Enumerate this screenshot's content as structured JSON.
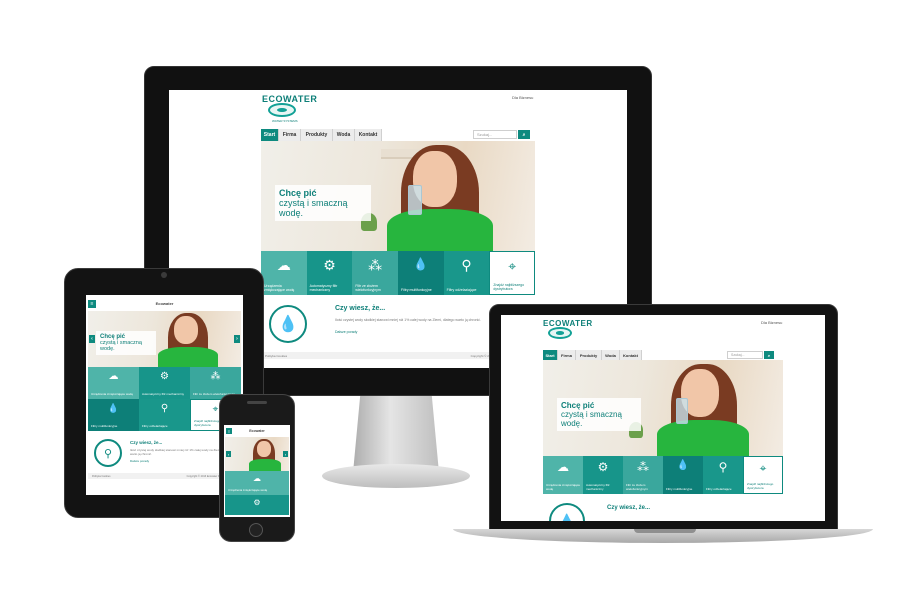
{
  "site": {
    "logo": "ECOWATER",
    "logo_tagline": "WATER SYSTEMS",
    "lang_link": "Dla Biznesu",
    "menu": [
      "Start",
      "Firma",
      "Produkty",
      "Woda",
      "Kontakt"
    ],
    "search_placeholder": "Szukaj...",
    "search_button": "⌕",
    "hero_line1": "Chcę pić",
    "hero_line2": "czystą i smaczną wodę.",
    "tiles": [
      {
        "label": "Urządzenia zmiękczające wodę",
        "icon": "cloud-icon",
        "glyph": "☁"
      },
      {
        "label": "Automatyczny filtr mechaniczny",
        "icon": "gears-icon",
        "glyph": "⚙"
      },
      {
        "label": "Filtr ze złożem wielofunkcyjnym",
        "icon": "molecules-icon",
        "glyph": "⁂"
      },
      {
        "label": "Filtry multifunkcyjne",
        "icon": "drops-icon",
        "glyph": "💧"
      },
      {
        "label": "Filtry odżelaziające",
        "icon": "tap-icon",
        "glyph": "⚲"
      },
      {
        "label": "Znajdź najbliższego dystrybutora",
        "icon": "map-pin-icon",
        "glyph": "⌖"
      }
    ],
    "did_you_know_title": "Czy wiesz, że...",
    "did_you_know_text": "Ilość czystej wody słodkiej stanowi mniej niż 1% całej wody na Ziemi, dlatego warto ją chronić.",
    "did_you_know_link": "Dalsze porady",
    "footer_left": "Polityka Cookies",
    "footer_right": "Copyright © 2013 Ecowater Poland Sp. z o.o."
  },
  "tablet": {
    "header_title": "Ecowater",
    "tile_labels": [
      "Urządzenia zmiękczające wodę",
      "Automatyczny filtr mechaniczny",
      "Filtr ze złożem wielofunkcyjnym",
      "Filtry multifunkcyjne",
      "Filtry odżelaziające",
      "Znajdź najbliższego dystrybutora"
    ]
  },
  "phone": {
    "header_title": "Ecowater",
    "tile_label": "Urządzenia zmiękczające wodę"
  },
  "colors": {
    "brand_teal": "#0e8a7f",
    "hero_shirt": "#27b53e"
  }
}
